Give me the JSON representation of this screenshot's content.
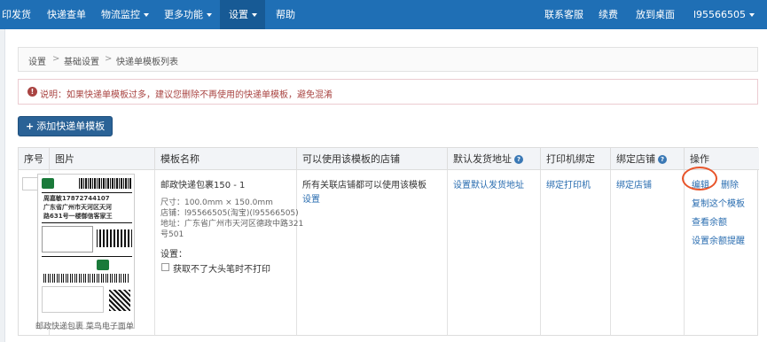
{
  "nav": {
    "items": [
      "印发货",
      "快递查单",
      "物流监控",
      "更多功能",
      "设置",
      "帮助"
    ],
    "right": [
      "联系客服",
      "续费",
      "放到桌面",
      "l95566505"
    ]
  },
  "breadcrumb": [
    "设置",
    "基础设置",
    "快递单模板列表"
  ],
  "breadcrumb_sep": ">",
  "notice": "说明：如果快递单模板过多，建议您删除不再使用的快递单模板，避免混淆",
  "add_button": "添加快递单模板",
  "table": {
    "headers": [
      "序号",
      "图片",
      "模板名称",
      "可以使用该模板的店铺",
      "默认发货地址",
      "打印机绑定",
      "绑定店铺",
      "操作"
    ],
    "row": {
      "name": "邮政快递包裹150 - 1",
      "size": "尺寸：100.0mm × 150.0mm",
      "shop": "店铺：l95566505(淘宝)(l95566505)",
      "address_line1": "地址：广东省广州市天河区德政中路321",
      "address_line2": "号501",
      "settings_label": "设置：",
      "settings_option": "获取不了大头笔时不打印",
      "shops_text": "所有关联店铺都可以使用该模板",
      "shops_link": "设置",
      "default_address": "设置默认发货地址",
      "printer": "绑定打印机",
      "bind_shop": "绑定店铺",
      "actions": [
        "编辑",
        "删除",
        "复制这个模板",
        "查看余额",
        "设置余额提醒"
      ],
      "image_caption": "邮政快递包裹 菜鸟电子面单",
      "label_text_1": "周嘉敏17872744107",
      "label_text_2": "广东省广州市天河区天河",
      "label_text_3": "路631号一楼御信客家王"
    }
  },
  "colors": {
    "nav": "#1f6fb5",
    "link": "#2a6db0",
    "notice": "#a94442",
    "circle": "#e8542a"
  }
}
